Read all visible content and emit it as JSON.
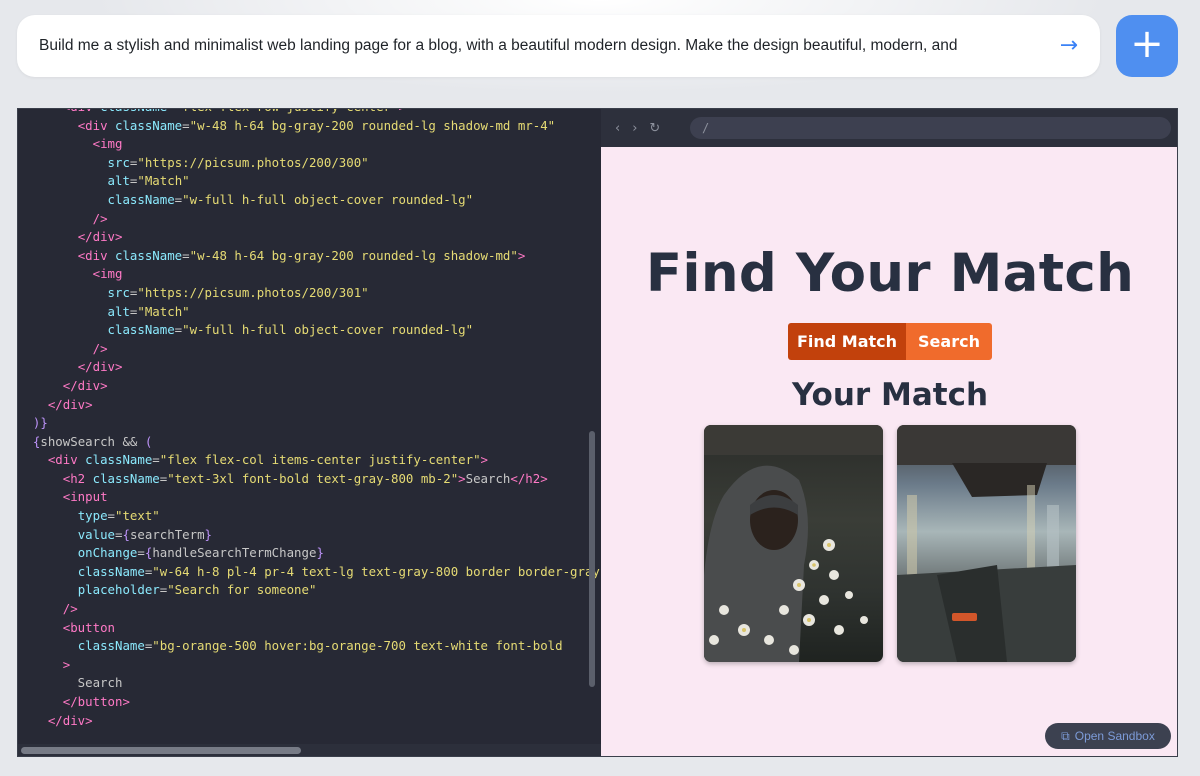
{
  "prompt": {
    "text": "Build me a stylish and minimalist web landing page for a blog, with a beautiful modern design. Make the design beautiful, modern, and",
    "send_icon": "→",
    "new_icon": "+"
  },
  "code_lines": [
    [
      [
        "p",
        "      "
      ],
      [
        "t",
        "<div "
      ],
      [
        "a",
        "className"
      ],
      [
        "p",
        "="
      ],
      [
        "s",
        "\"flex flex-row justify-center\""
      ],
      [
        "t",
        ">"
      ]
    ],
    [
      [
        "p",
        "        "
      ],
      [
        "t",
        "<div "
      ],
      [
        "a",
        "className"
      ],
      [
        "p",
        "="
      ],
      [
        "s",
        "\"w-48 h-64 bg-gray-200 rounded-lg shadow-md mr-4\""
      ]
    ],
    [
      [
        "p",
        "          "
      ],
      [
        "t",
        "<img"
      ]
    ],
    [
      [
        "p",
        "            "
      ],
      [
        "a",
        "src"
      ],
      [
        "p",
        "="
      ],
      [
        "s",
        "\"https://picsum.photos/200/300\""
      ]
    ],
    [
      [
        "p",
        "            "
      ],
      [
        "a",
        "alt"
      ],
      [
        "p",
        "="
      ],
      [
        "s",
        "\"Match\""
      ]
    ],
    [
      [
        "p",
        "            "
      ],
      [
        "a",
        "className"
      ],
      [
        "p",
        "="
      ],
      [
        "s",
        "\"w-full h-full object-cover rounded-lg\""
      ]
    ],
    [
      [
        "p",
        "          "
      ],
      [
        "t",
        "/>"
      ]
    ],
    [
      [
        "p",
        "        "
      ],
      [
        "t",
        "</div>"
      ]
    ],
    [
      [
        "p",
        "        "
      ],
      [
        "t",
        "<div "
      ],
      [
        "a",
        "className"
      ],
      [
        "p",
        "="
      ],
      [
        "s",
        "\"w-48 h-64 bg-gray-200 rounded-lg shadow-md\""
      ],
      [
        "t",
        ">"
      ]
    ],
    [
      [
        "p",
        "          "
      ],
      [
        "t",
        "<img"
      ]
    ],
    [
      [
        "p",
        "            "
      ],
      [
        "a",
        "src"
      ],
      [
        "p",
        "="
      ],
      [
        "s",
        "\"https://picsum.photos/200/301\""
      ]
    ],
    [
      [
        "p",
        "            "
      ],
      [
        "a",
        "alt"
      ],
      [
        "p",
        "="
      ],
      [
        "s",
        "\"Match\""
      ]
    ],
    [
      [
        "p",
        "            "
      ],
      [
        "a",
        "className"
      ],
      [
        "p",
        "="
      ],
      [
        "s",
        "\"w-full h-full object-cover rounded-lg\""
      ]
    ],
    [
      [
        "p",
        "          "
      ],
      [
        "t",
        "/>"
      ]
    ],
    [
      [
        "p",
        "        "
      ],
      [
        "t",
        "</div>"
      ]
    ],
    [
      [
        "p",
        "      "
      ],
      [
        "t",
        "</div>"
      ]
    ],
    [
      [
        "p",
        "    "
      ],
      [
        "t",
        "</div>"
      ]
    ],
    [
      [
        "p",
        "  "
      ],
      [
        "b",
        ")}"
      ]
    ],
    [
      [
        "p",
        "  "
      ],
      [
        "b",
        "{"
      ],
      [
        "p",
        "showSearch && "
      ],
      [
        "b",
        "("
      ]
    ],
    [
      [
        "p",
        "    "
      ],
      [
        "t",
        "<div "
      ],
      [
        "a",
        "className"
      ],
      [
        "p",
        "="
      ],
      [
        "s",
        "\"flex flex-col items-center justify-center\""
      ],
      [
        "t",
        ">"
      ]
    ],
    [
      [
        "p",
        "      "
      ],
      [
        "t",
        "<h2 "
      ],
      [
        "a",
        "className"
      ],
      [
        "p",
        "="
      ],
      [
        "s",
        "\"text-3xl font-bold text-gray-800 mb-2\""
      ],
      [
        "t",
        ">"
      ],
      [
        "p",
        "Search"
      ],
      [
        "t",
        "</h2>"
      ]
    ],
    [
      [
        "p",
        "      "
      ],
      [
        "t",
        "<input"
      ]
    ],
    [
      [
        "p",
        "        "
      ],
      [
        "a",
        "type"
      ],
      [
        "p",
        "="
      ],
      [
        "s",
        "\"text\""
      ]
    ],
    [
      [
        "p",
        "        "
      ],
      [
        "a",
        "value"
      ],
      [
        "p",
        "="
      ],
      [
        "b",
        "{"
      ],
      [
        "p",
        "searchTerm"
      ],
      [
        "b",
        "}"
      ]
    ],
    [
      [
        "p",
        "        "
      ],
      [
        "a",
        "onChange"
      ],
      [
        "p",
        "="
      ],
      [
        "b",
        "{"
      ],
      [
        "p",
        "handleSearchTermChange"
      ],
      [
        "b",
        "}"
      ]
    ],
    [
      [
        "p",
        "        "
      ],
      [
        "a",
        "className"
      ],
      [
        "p",
        "="
      ],
      [
        "s",
        "\"w-64 h-8 pl-4 pr-4 text-lg text-gray-800 border border-gray"
      ]
    ],
    [
      [
        "p",
        "        "
      ],
      [
        "a",
        "placeholder"
      ],
      [
        "p",
        "="
      ],
      [
        "s",
        "\"Search for someone\""
      ]
    ],
    [
      [
        "p",
        "      "
      ],
      [
        "t",
        "/>"
      ]
    ],
    [
      [
        "p",
        "      "
      ],
      [
        "t",
        "<button"
      ]
    ],
    [
      [
        "p",
        "        "
      ],
      [
        "a",
        "className"
      ],
      [
        "p",
        "="
      ],
      [
        "s",
        "\"bg-orange-500 hover:bg-orange-700 text-white font-bold"
      ]
    ],
    [
      [
        "p",
        "      "
      ],
      [
        "t",
        ">"
      ]
    ],
    [
      [
        "p",
        "        Search"
      ]
    ],
    [
      [
        "p",
        "      "
      ],
      [
        "t",
        "</button>"
      ]
    ],
    [
      [
        "p",
        "    "
      ],
      [
        "t",
        "</div>"
      ]
    ]
  ],
  "browser": {
    "back_icon": "‹",
    "forward_icon": "›",
    "reload_icon": "↻",
    "url": "/"
  },
  "preview": {
    "title": "Find Your Match",
    "find_button": "Find Match",
    "search_button": "Search",
    "subtitle": "Your Match",
    "open_sandbox": "Open Sandbox",
    "open_sandbox_icon": "⧉"
  },
  "colors": {
    "accent": "#4f8ff0",
    "find_button": "#c2410c",
    "search_button": "#f06b2c",
    "preview_bg": "#fae8f3",
    "editor_bg": "#272935"
  }
}
